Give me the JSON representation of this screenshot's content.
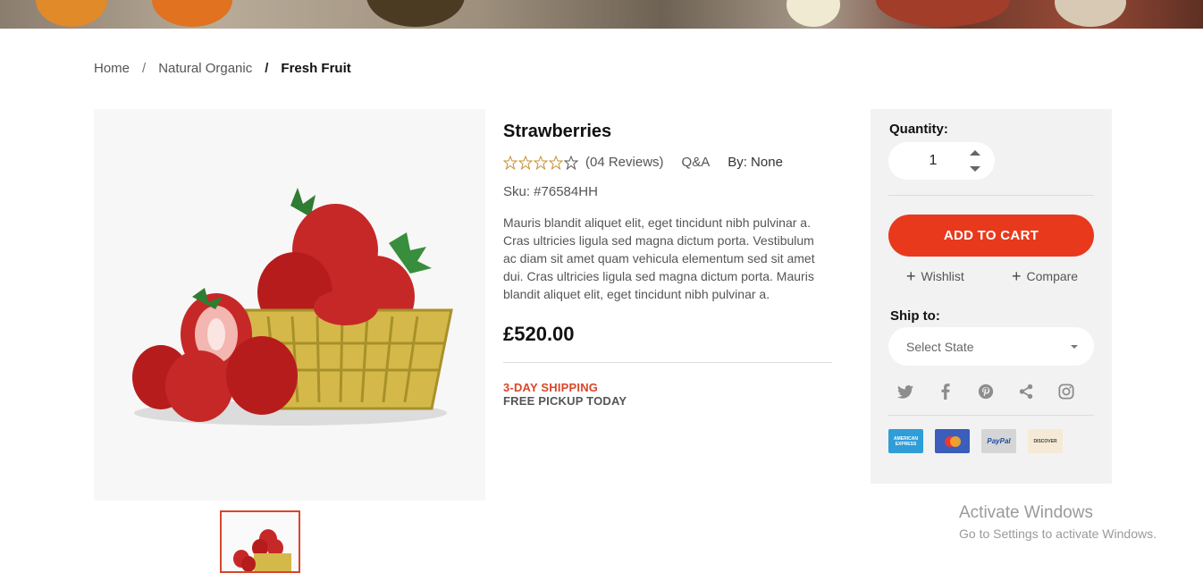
{
  "breadcrumb": {
    "home": "Home",
    "category": "Natural Organic",
    "current": "Fresh Fruit",
    "separator": "/"
  },
  "product": {
    "title": "Strawberries",
    "reviews": "(04 Reviews)",
    "qa": "Q&A",
    "by": "By: None",
    "sku": "Sku: #76584HH",
    "description": "Mauris blandit aliquet elit, eget tincidunt nibh pulvinar a. Cras ultricies ligula sed magna dictum porta. Vestibulum ac diam sit amet quam vehicula elementum sed sit amet dui. Cras ultricies ligula sed magna dictum porta. Mauris blandit aliquet elit, eget tincidunt nibh pulvinar a.",
    "price": "£520.00",
    "shipping": "3-DAY SHIPPING",
    "pickup": "FREE PICKUP TODAY",
    "rating": 0,
    "rating_max": 5
  },
  "panel": {
    "quantity_label": "Quantity:",
    "quantity": "1",
    "add_to_cart": "ADD TO CART",
    "wishlist": "Wishlist",
    "compare": "Compare",
    "ship_to": "Ship to:",
    "select_placeholder": "Select State",
    "socials": [
      "twitter-icon",
      "facebook-icon",
      "pinterest-icon",
      "share-icon",
      "instagram-icon"
    ],
    "cards": [
      {
        "name": "amex",
        "label": "AMERICAN EXPRESS"
      },
      {
        "name": "mastercard",
        "label": ""
      },
      {
        "name": "paypal",
        "label": "PayPal"
      },
      {
        "name": "discover",
        "label": "DISCOVER"
      }
    ]
  },
  "watermark": {
    "title": "Activate Windows",
    "subtitle": "Go to Settings to activate Windows."
  },
  "colors": {
    "accent": "#e8391d",
    "shipping": "#d9462a",
    "panel_bg": "#f2f2f2"
  }
}
